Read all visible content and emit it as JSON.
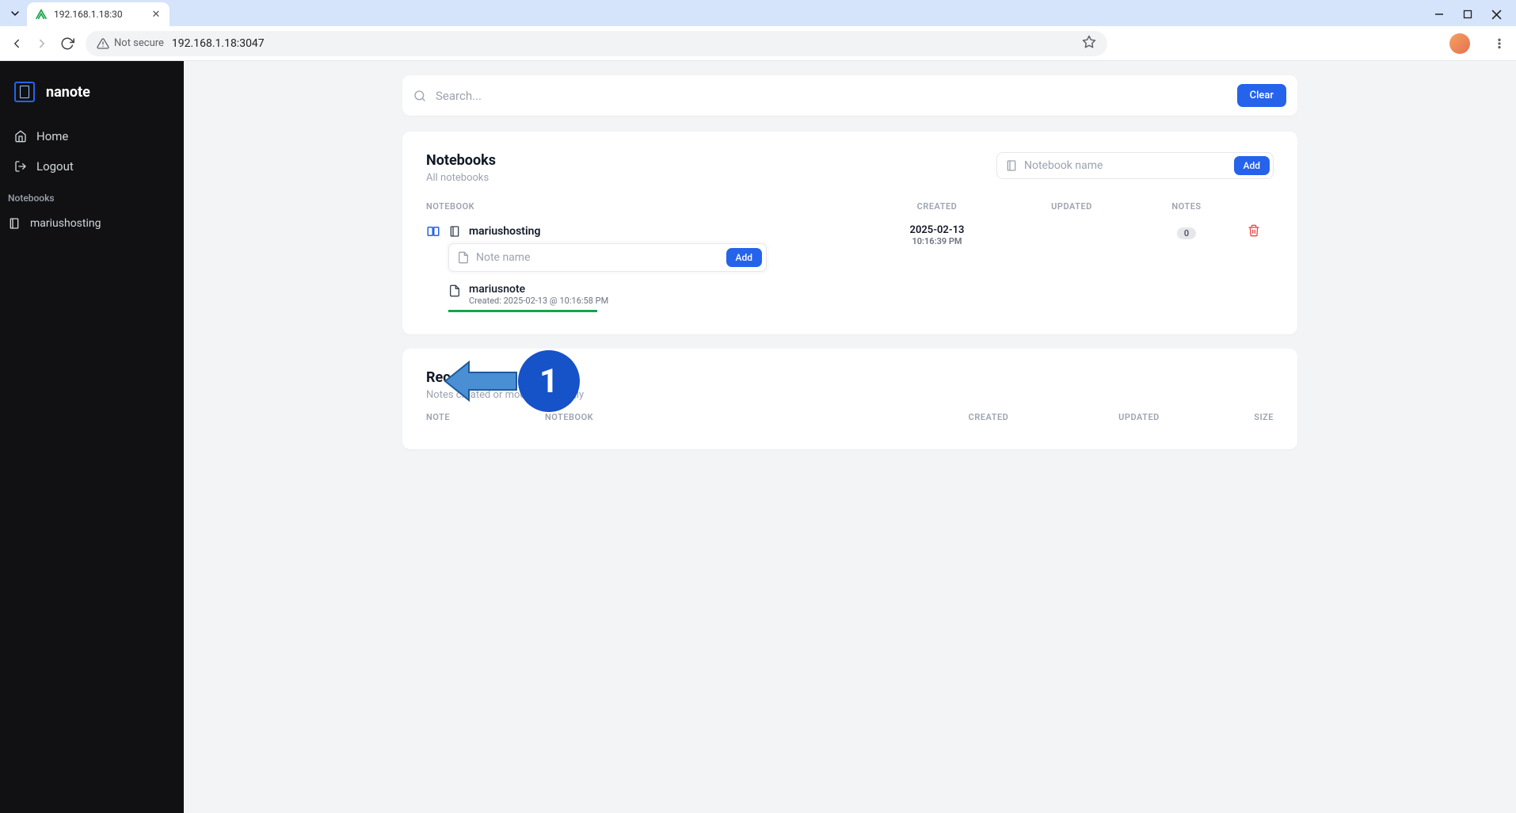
{
  "browser": {
    "tab_title": "192.168.1.18:30",
    "not_secure_label": "Not secure",
    "url": "192.168.1.18:3047"
  },
  "sidebar": {
    "brand": "nanote",
    "nav": {
      "home": "Home",
      "logout": "Logout"
    },
    "section_label": "Notebooks",
    "notebooks": [
      {
        "name": "mariushosting"
      }
    ]
  },
  "search": {
    "placeholder": "Search...",
    "clear_label": "Clear"
  },
  "notebooks_panel": {
    "title": "Notebooks",
    "subtitle": "All notebooks",
    "add_placeholder": "Notebook name",
    "add_label": "Add",
    "columns": {
      "notebook": "NOTEBOOK",
      "created": "CREATED",
      "updated": "UPDATED",
      "notes": "NOTES"
    },
    "rows": [
      {
        "name": "mariushosting",
        "created_date": "2025-02-13",
        "created_time": "10:16:39 PM",
        "updated_date": "",
        "updated_time": "",
        "notes_count": "0"
      }
    ],
    "note_input_placeholder": "Note name",
    "note_add_label": "Add",
    "notes": [
      {
        "name": "mariusnote",
        "meta": "Created: 2025-02-13 @ 10:16:58 PM"
      }
    ]
  },
  "recent_panel": {
    "title": "Recent Notes",
    "subtitle": "Notes created or modified recently",
    "columns": {
      "note": "NOTE",
      "notebook": "NOTEBOOK",
      "created": "CREATED",
      "updated": "UPDATED",
      "size": "SIZE"
    }
  },
  "annotation": {
    "badge": "1"
  }
}
